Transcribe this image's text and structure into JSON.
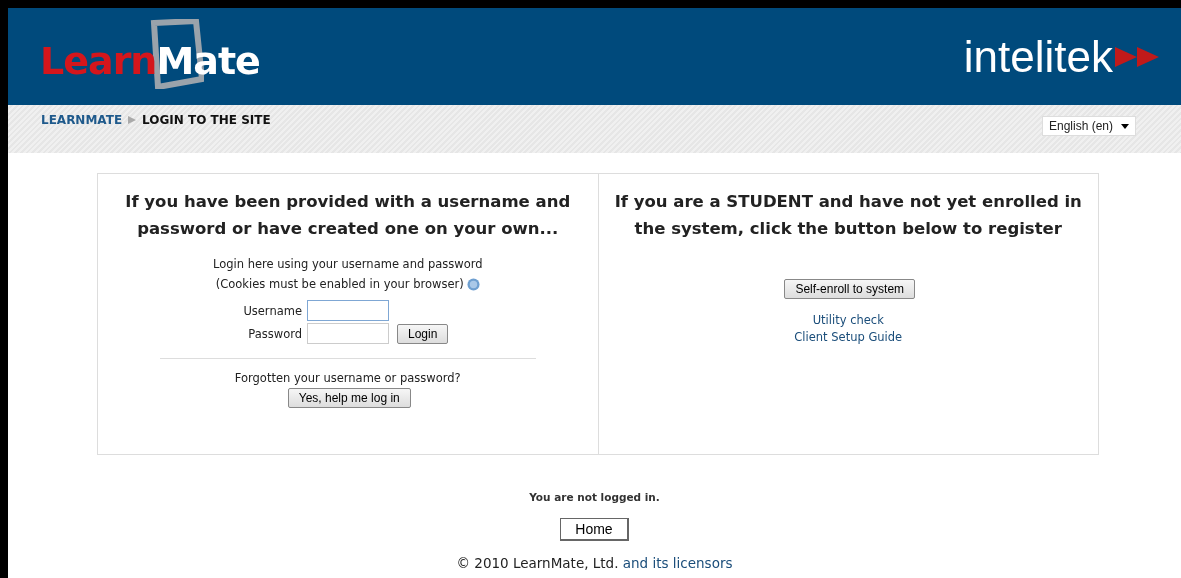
{
  "header": {
    "logo": {
      "part1": "Learn",
      "part2": "Mate"
    },
    "brand": "intelitek"
  },
  "breadcrumb": {
    "items": [
      {
        "label": "LEARNMATE",
        "link": true
      },
      {
        "label": "LOGIN TO THE SITE",
        "link": false
      }
    ]
  },
  "language": {
    "value": "English (en)"
  },
  "login_panel": {
    "heading": "If you have been provided with a username and password or have created one on your own...",
    "intro": "Login here using your username and password",
    "cookies_note": "(Cookies must be enabled in your browser)",
    "username_label": "Username",
    "password_label": "Password",
    "login_button": "Login",
    "forgot_text": "Forgotten your username or password?",
    "help_button": "Yes, help me log in"
  },
  "signup_panel": {
    "heading": "If you are a STUDENT and have not yet enrolled in the system, click the button below to register",
    "enroll_button": "Self-enroll to system",
    "links": [
      "Utility check",
      "Client Setup Guide"
    ]
  },
  "footer": {
    "status": "You are not logged in.",
    "home_button": "Home",
    "copyright": "© 2010 LearnMate, Ltd.",
    "licensors_link": "and its licensors"
  }
}
